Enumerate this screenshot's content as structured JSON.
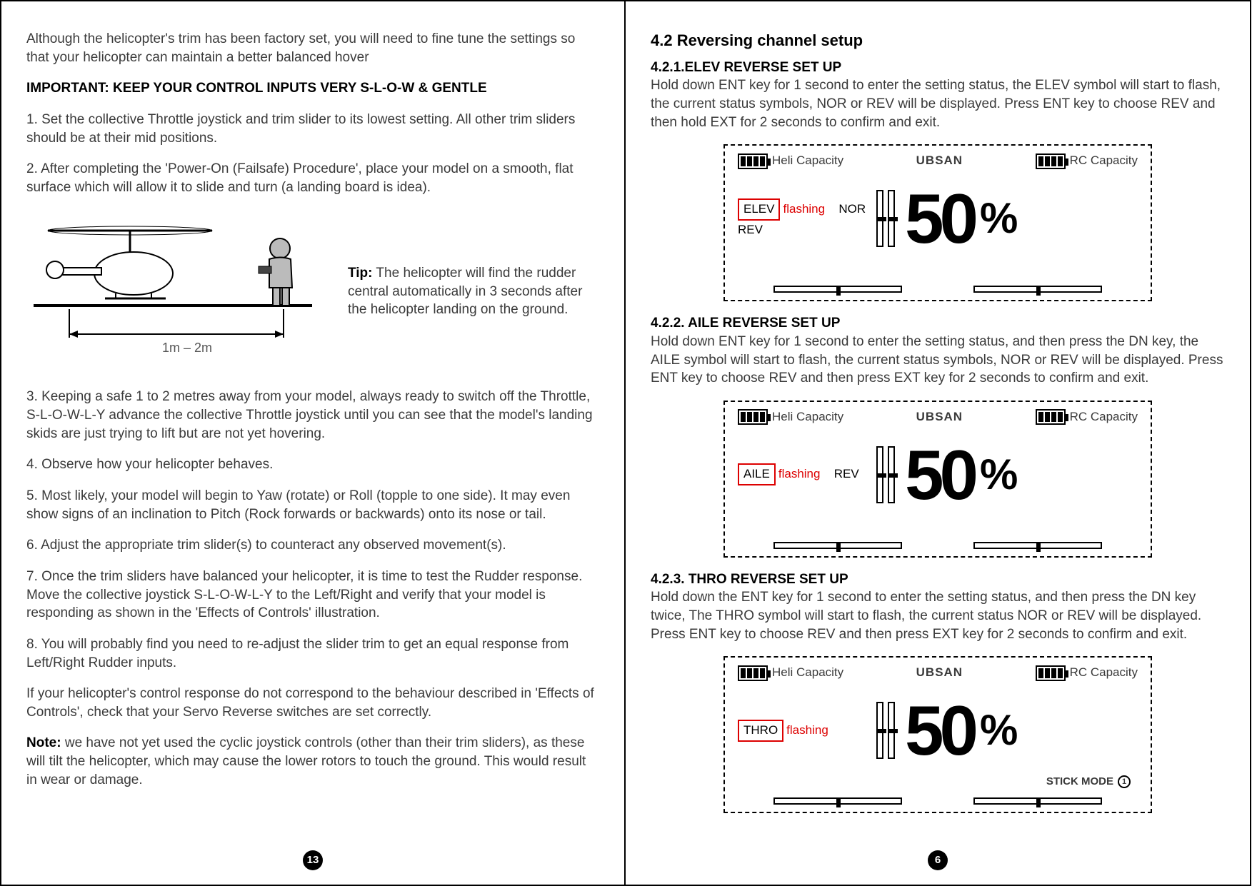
{
  "left": {
    "intro": "Although the helicopter's trim has been factory set, you will need to fine tune the settings so that your helicopter can maintain a better balanced hover",
    "important": "IMPORTANT: KEEP YOUR CONTROL INPUTS VERY S-L-O-W & GENTLE",
    "step1": "1. Set the collective Throttle joystick and trim slider to its lowest setting. All other trim sliders should be at their mid positions.",
    "step2": "2. After completing the 'Power-On (Failsafe) Procedure', place your model on a smooth, flat surface which will allow it to slide and turn (a landing board is idea).",
    "tip_label": "Tip:",
    "tip_text": " The helicopter will find the rudder central automatically in 3 seconds after the helicopter landing on the ground.",
    "figure_caption": "1m – 2m",
    "step3": "3. Keeping a safe 1 to 2 metres away from your model, always ready to switch off the Throttle, S-L-O-W-L-Y advance the collective Throttle joystick until you can see that the model's landing skids are just trying to lift but are not yet hovering.",
    "step4": "4. Observe how your helicopter behaves.",
    "step5": "5. Most likely, your model will begin to Yaw (rotate) or Roll (topple to one side). It may even show signs of an inclination to Pitch (Rock forwards or backwards) onto its nose or tail.",
    "step6": "6. Adjust the appropriate trim slider(s) to counteract any observed movement(s).",
    "step7": "7. Once the trim sliders have balanced your helicopter, it is time to test the Rudder response. Move the collective joystick S-L-O-W-L-Y to the Left/Right and verify that your model is responding as shown in the 'Effects of Controls' illustration.",
    "step8": "8. You will probably find you need to re-adjust the slider trim to get an equal response from Left/Right Rudder inputs.",
    "note_pre": "If your helicopter's control response do not correspond to the behaviour described in 'Effects of Controls', check that your Servo Reverse switches are set correctly.",
    "note_label": "Note:",
    "note_text": " we have not yet used the cyclic joystick controls (other than their trim sliders), as these will tilt the helicopter, which may cause the lower rotors to touch the ground. This would result in wear or damage.",
    "page_num": "13"
  },
  "right": {
    "heading": "4.2 Reversing channel setup",
    "s1_title": "4.2.1.ELEV REVERSE SET UP",
    "s1_body": "Hold down ENT key for 1 second to enter the setting status, the ELEV symbol will start to flash, the current status symbols, NOR or REV will be displayed. Press ENT key to choose REV and then hold EXT for 2 seconds to confirm and exit.",
    "s2_title": "4.2.2. AILE REVERSE SET UP",
    "s2_body": "Hold down ENT key for 1 second to enter the setting status, and then press the DN key, the AILE symbol will start to flash, the current status symbols, NOR or REV will be displayed. Press ENT key to choose REV and then press EXT key for 2 seconds to confirm and exit.",
    "s3_title": "4.2.3. THRO REVERSE SET UP",
    "s3_body": "Hold down the ENT key for 1 second to enter the setting status, and then press the DN key twice, The THRO symbol will start to flash, the current status NOR or REV will be displayed. Press ENT key to choose REV and then press EXT key for 2 seconds to confirm and exit.",
    "lcd": {
      "heli_cap": "Heli Capacity",
      "rc_cap": "RC Capacity",
      "brand": "UBSAN",
      "flashing": "flashing",
      "elev": "ELEV",
      "aile": "AILE",
      "thro": "THRO",
      "nor": "NOR",
      "rev": "REV",
      "value": "50",
      "pct": "%",
      "stick_mode": "STICK MODE",
      "mode_num": "1"
    },
    "page_num": "6"
  }
}
